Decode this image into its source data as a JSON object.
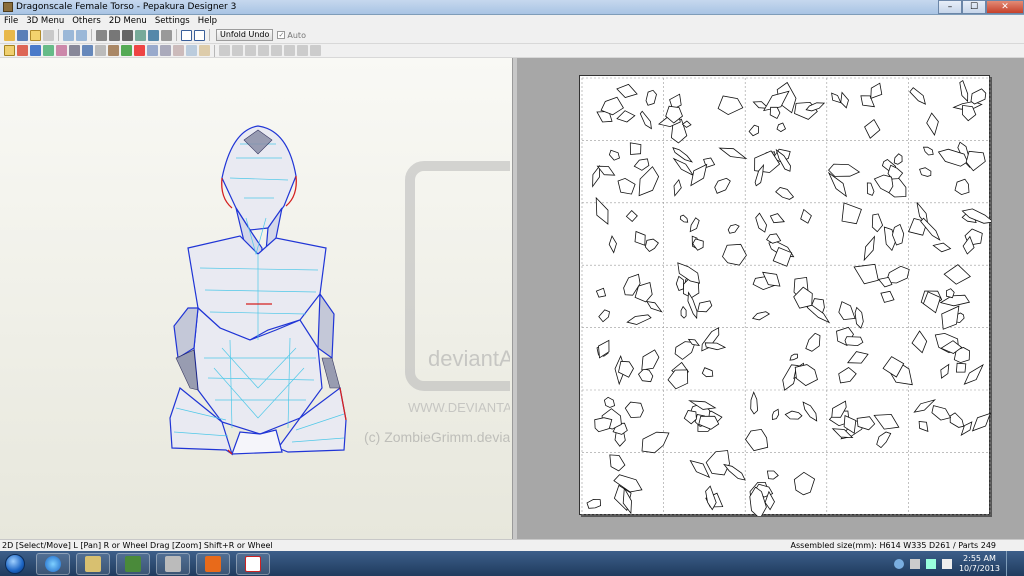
{
  "window": {
    "title": "Dragonscale Female Torso - Pepakura Designer 3",
    "min": "–",
    "max": "☐",
    "close": "✕"
  },
  "menu": {
    "items": [
      "File",
      "3D Menu",
      "Others",
      "2D Menu",
      "Settings",
      "Help"
    ]
  },
  "toolbar": {
    "unfold_undo": "Unfold Undo",
    "auto_label": "Auto",
    "auto_checked": "✓"
  },
  "watermark": {
    "brand": "deviantART",
    "url": "WWW.DEVIANTART.COM",
    "credit": "(c) ZombieGrimm.deviantart.com"
  },
  "status": {
    "left": "2D [Select/Move] L [Pan] R or Wheel Drag [Zoom] Shift+R or Wheel",
    "right": "Assembled size(mm): H614 W335 D261 / Parts 249"
  },
  "taskbar": {
    "apps": [
      "windows-explorer",
      "internet-explorer",
      "folder",
      "media",
      "calculator",
      "app",
      "pepakura"
    ],
    "time": "2:55 AM",
    "date": "10/7/2013"
  },
  "colors": {
    "model_edge": "#2035d6",
    "model_fold": "#4fc8e8",
    "cut_edge": "#d42020",
    "taskbar": "#1f3b5e"
  }
}
